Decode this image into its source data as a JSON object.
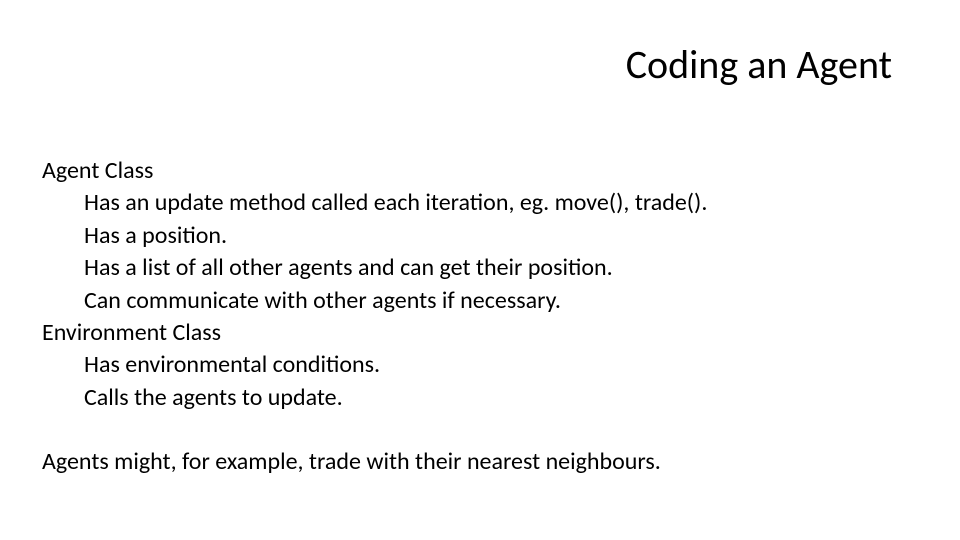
{
  "title": "Coding an Agent",
  "body": {
    "agent_heading": "Agent Class",
    "agent_items": [
      "Has an update method called each iteration, eg. move(), trade().",
      "Has a position.",
      "Has a list of all other agents and can get their position.",
      "Can communicate with other agents if necessary."
    ],
    "env_heading": "Environment Class",
    "env_items": [
      "Has environmental conditions.",
      "Calls the agents to update."
    ],
    "footer": "Agents might, for example, trade with their nearest neighbours."
  }
}
